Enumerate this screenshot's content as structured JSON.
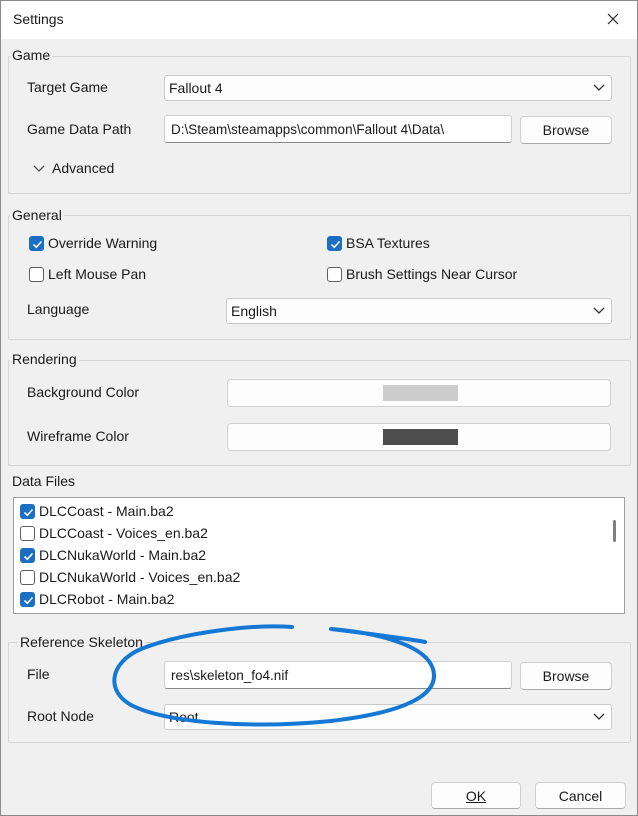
{
  "window": {
    "title": "Settings"
  },
  "game": {
    "legend": "Game",
    "target_game_label": "Target Game",
    "target_game_value": "Fallout 4",
    "data_path_label": "Game Data Path",
    "data_path_value": "D:\\Steam\\steamapps\\common\\Fallout 4\\Data\\",
    "browse_label": "Browse",
    "advanced_label": "Advanced"
  },
  "general": {
    "legend": "General",
    "override_warning": {
      "label": "Override Warning",
      "checked": true
    },
    "bsa_textures": {
      "label": "BSA Textures",
      "checked": true
    },
    "left_mouse_pan": {
      "label": "Left Mouse Pan",
      "checked": false
    },
    "brush_near_cursor": {
      "label": "Brush Settings Near Cursor",
      "checked": false
    },
    "language_label": "Language",
    "language_value": "English"
  },
  "rendering": {
    "legend": "Rendering",
    "background_color_label": "Background Color",
    "background_color": "#cccccc",
    "wireframe_color_label": "Wireframe Color",
    "wireframe_color": "#4d4d4d"
  },
  "data_files": {
    "legend": "Data Files",
    "items": [
      {
        "label": "DLCCoast - Main.ba2",
        "checked": true
      },
      {
        "label": "DLCCoast - Voices_en.ba2",
        "checked": false
      },
      {
        "label": "DLCNukaWorld - Main.ba2",
        "checked": true
      },
      {
        "label": "DLCNukaWorld - Voices_en.ba2",
        "checked": false
      },
      {
        "label": "DLCRobot - Main.ba2",
        "checked": true
      }
    ]
  },
  "reference_skeleton": {
    "legend": "Reference Skeleton",
    "file_label": "File",
    "file_value": "res\\skeleton_fo4.nif",
    "browse_label": "Browse",
    "root_node_label": "Root Node",
    "root_node_value": "Root"
  },
  "footer": {
    "ok_label": "OK",
    "cancel_label": "Cancel"
  },
  "colors": {
    "accent": "#1a6fc2",
    "annotation": "#1478d4"
  }
}
